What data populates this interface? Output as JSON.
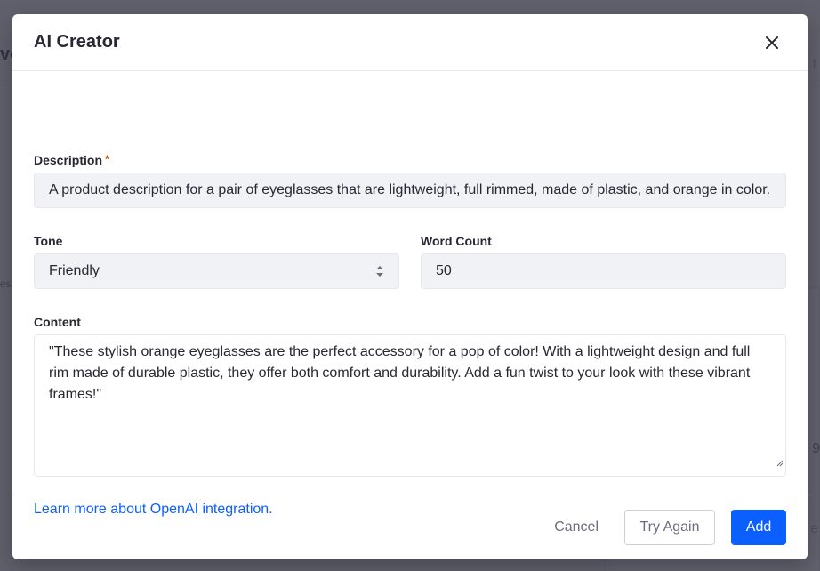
{
  "modal": {
    "title": "AI Creator",
    "description": {
      "label": "Description",
      "required_mark": "*",
      "value": "A product description for a pair of eyeglasses that are lightweight, full rimmed, made of plastic, and orange in color."
    },
    "tone": {
      "label": "Tone",
      "selected": "Friendly"
    },
    "word_count": {
      "label": "Word Count",
      "value": "50"
    },
    "content": {
      "label": "Content",
      "value": "\"These stylish orange eyeglasses are the perfect accessory for a pop of color! With a lightweight design and full rim made of durable plastic, they offer both comfort and durability. Add a fun twist to your look with these vibrant frames!\""
    },
    "learn_link": "Learn more about OpenAI integration.",
    "footer": {
      "cancel_label": "Cancel",
      "try_again_label": "Try Again",
      "add_label": "Add"
    }
  },
  "background": {
    "title_fragment": "ve",
    "small_fragment": "es",
    "right_fragment": "t",
    "right_number": "9",
    "right_number2": "e"
  },
  "colors": {
    "primary": "#0b5fff",
    "required": "#b95000",
    "input_bg": "#f1f2f5",
    "backdrop": "#343644"
  },
  "icons": {
    "close": "close-icon",
    "select_caret": "caret-double-icon",
    "resize": "resize-grip-icon"
  }
}
